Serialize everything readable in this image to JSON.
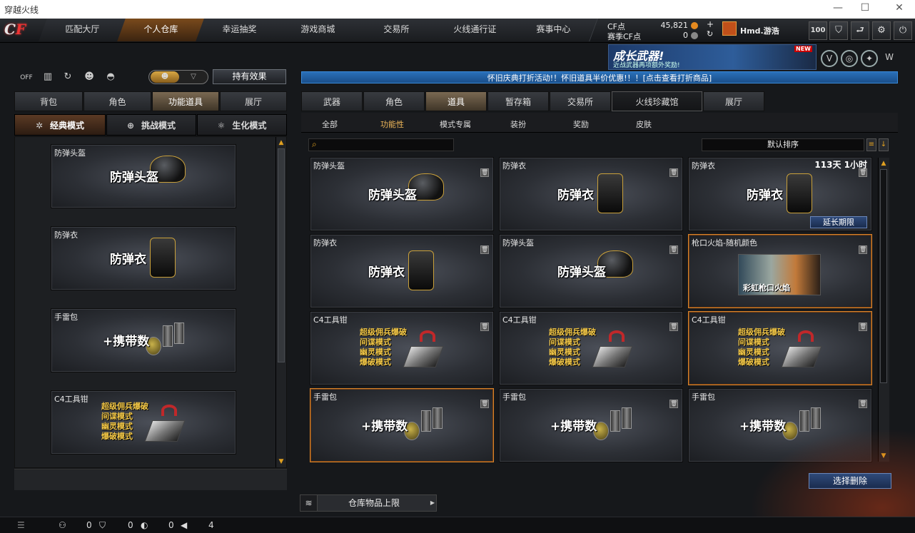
{
  "window": {
    "title": "穿越火线",
    "controls": [
      "—",
      "☐",
      "✕"
    ]
  },
  "nav": {
    "logo_a": "C",
    "logo_b": "F",
    "tabs": [
      "匹配大厅",
      "个人仓库",
      "幸运抽奖",
      "游戏商城",
      "交易所",
      "火线通行证",
      "赛事中心"
    ]
  },
  "currency": {
    "cf_label": "CF点",
    "cf_value": "45,821",
    "event_label": "赛季CF点",
    "event_value": "0"
  },
  "user": {
    "name": "Hmd.游浩",
    "level": "100"
  },
  "banner": {
    "title": "成长武器!",
    "subtitle": "近战武器再项额外奖励!",
    "badge": "NEW"
  },
  "left": {
    "icons": [
      "off-icon",
      "ranking-icon",
      "refresh-icon",
      "user-icon",
      "gift-icon"
    ],
    "effect_button": "持有效果",
    "tabs": [
      "背包",
      "角色",
      "功能道具",
      "展厅"
    ],
    "modes": [
      {
        "icon": "✲",
        "label": "经典模式"
      },
      {
        "icon": "⊕",
        "label": "挑战模式"
      },
      {
        "icon": "⚛",
        "label": "生化模式"
      }
    ],
    "items": [
      {
        "name": "防弹头盔",
        "big": "防弹头盔",
        "kind": "helmet"
      },
      {
        "name": "防弹衣",
        "big": "防弹衣",
        "kind": "vest"
      },
      {
        "name": "手雷包",
        "big": "+携带数",
        "kind": "grenade"
      },
      {
        "name": "C4工具钳",
        "big": "超级佣兵爆破\n间谍模式\n幽灵模式\n爆破模式",
        "kind": "c4"
      }
    ]
  },
  "right": {
    "notice": "怀旧庆典打折活动!！怀旧道具半价优惠!！！[点击查看打折商品]",
    "tabs": [
      "武器",
      "角色",
      "道具",
      "暂存箱",
      "交易所",
      "火线珍藏馆",
      "展厅"
    ],
    "subtabs": [
      "全部",
      "功能性",
      "模式专属",
      "装扮",
      "奖励",
      "皮肤"
    ],
    "sort_label": "默认排序",
    "items": [
      {
        "name": "防弹头盔",
        "big": "防弹头盔",
        "kind": "helmet"
      },
      {
        "name": "防弹衣",
        "big": "防弹衣",
        "kind": "vest"
      },
      {
        "name": "防弹衣",
        "big": "防弹衣",
        "kind": "vest",
        "timer": "113天 1小时",
        "extend": "延长期限"
      },
      {
        "name": "防弹衣",
        "big": "防弹衣",
        "kind": "vest"
      },
      {
        "name": "防弹头盔",
        "big": "防弹头盔",
        "kind": "helmet"
      },
      {
        "name": "枪口火焰-随机颜色",
        "big": "彩虹枪口火焰",
        "kind": "flame"
      },
      {
        "name": "C4工具钳",
        "big": "超级佣兵爆破\n间谍模式\n幽灵模式\n爆破模式",
        "kind": "c4"
      },
      {
        "name": "C4工具钳",
        "big": "超级佣兵爆破\n间谍模式\n幽灵模式\n爆破模式",
        "kind": "c4"
      },
      {
        "name": "C4工具钳",
        "big": "超级佣兵爆破\n间谍模式\n幽灵模式\n爆破模式",
        "kind": "c4"
      },
      {
        "name": "手雷包",
        "big": "+携带数",
        "kind": "grenade"
      },
      {
        "name": "手雷包",
        "big": "+携带数",
        "kind": "grenade"
      },
      {
        "name": "手雷包",
        "big": "+携带数",
        "kind": "grenade"
      }
    ],
    "delete_button": "选择删除",
    "capacity_label": "仓库物品上限"
  },
  "status": {
    "a": "0",
    "b": "0",
    "c": "0",
    "d": "4"
  },
  "colors": {
    "accent": "#e58a1f",
    "highlight": "#d8842c",
    "blue": "#2a6fb8"
  }
}
